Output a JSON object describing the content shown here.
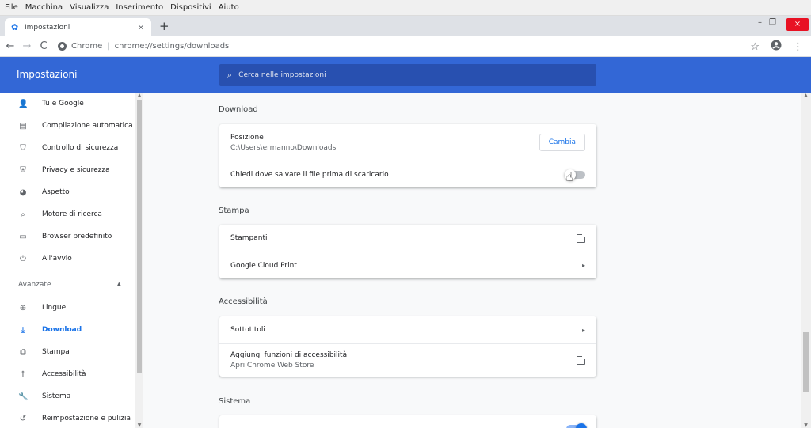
{
  "menubar": [
    "File",
    "Macchina",
    "Visualizza",
    "Inserimento",
    "Dispositivi",
    "Aiuto"
  ],
  "tab": {
    "title": "Impostazioni",
    "close": "×",
    "new_tab": "+"
  },
  "window": {
    "minimize": "–",
    "restore": "❐",
    "close": "×"
  },
  "toolbar": {
    "back": "←",
    "forward": "→",
    "reload": "C",
    "site_label": "Chrome",
    "separator": "|",
    "url": "chrome://settings/downloads",
    "star": "☆",
    "menu": "⋮"
  },
  "header": {
    "title": "Impostazioni",
    "search_placeholder": "Cerca nelle impostazioni"
  },
  "sidebar": {
    "items": [
      {
        "label": "Tu e Google",
        "icon": "person-icon",
        "glyph": "👤"
      },
      {
        "label": "Compilazione automatica",
        "icon": "clipboard-icon",
        "glyph": "▤"
      },
      {
        "label": "Controllo di sicurezza",
        "icon": "shield-check-icon",
        "glyph": "⛉"
      },
      {
        "label": "Privacy e sicurezza",
        "icon": "shield-icon",
        "glyph": "⛨"
      },
      {
        "label": "Aspetto",
        "icon": "palette-icon",
        "glyph": "◕"
      },
      {
        "label": "Motore di ricerca",
        "icon": "search-icon",
        "glyph": "⌕"
      },
      {
        "label": "Browser predefinito",
        "icon": "browser-icon",
        "glyph": "▭"
      },
      {
        "label": "All'avvio",
        "icon": "power-icon",
        "glyph": "⏻"
      }
    ],
    "group_label": "Avanzate",
    "group_arrow": "▲",
    "advanced_items": [
      {
        "label": "Lingue",
        "icon": "globe-icon",
        "glyph": "⊕"
      },
      {
        "label": "Download",
        "icon": "download-icon",
        "glyph": "⤓",
        "active": true
      },
      {
        "label": "Stampa",
        "icon": "printer-icon",
        "glyph": "⎙"
      },
      {
        "label": "Accessibilità",
        "icon": "accessibility-icon",
        "glyph": "☨"
      },
      {
        "label": "Sistema",
        "icon": "wrench-icon",
        "glyph": "🔧"
      },
      {
        "label": "Reimpostazione e pulizia",
        "icon": "restore-icon",
        "glyph": "↺"
      }
    ]
  },
  "sections": {
    "download": {
      "title": "Download",
      "location_label": "Posizione",
      "location_value": "C:\\Users\\ermanno\\Downloads",
      "change_button": "Cambia",
      "ask_label": "Chiedi dove salvare il file prima di scaricarlo",
      "ask_enabled": false
    },
    "print": {
      "title": "Stampa",
      "printers_label": "Stampanti",
      "cloud_label": "Google Cloud Print",
      "arrow": "▸"
    },
    "accessibility": {
      "title": "Accessibilità",
      "captions_label": "Sottotitoli",
      "add_features_label": "Aggiungi funzioni di accessibilità",
      "add_features_sub": "Apri Chrome Web Store",
      "arrow": "▸"
    },
    "system": {
      "title": "Sistema",
      "first_row_enabled": true
    }
  },
  "cursor": "☝"
}
